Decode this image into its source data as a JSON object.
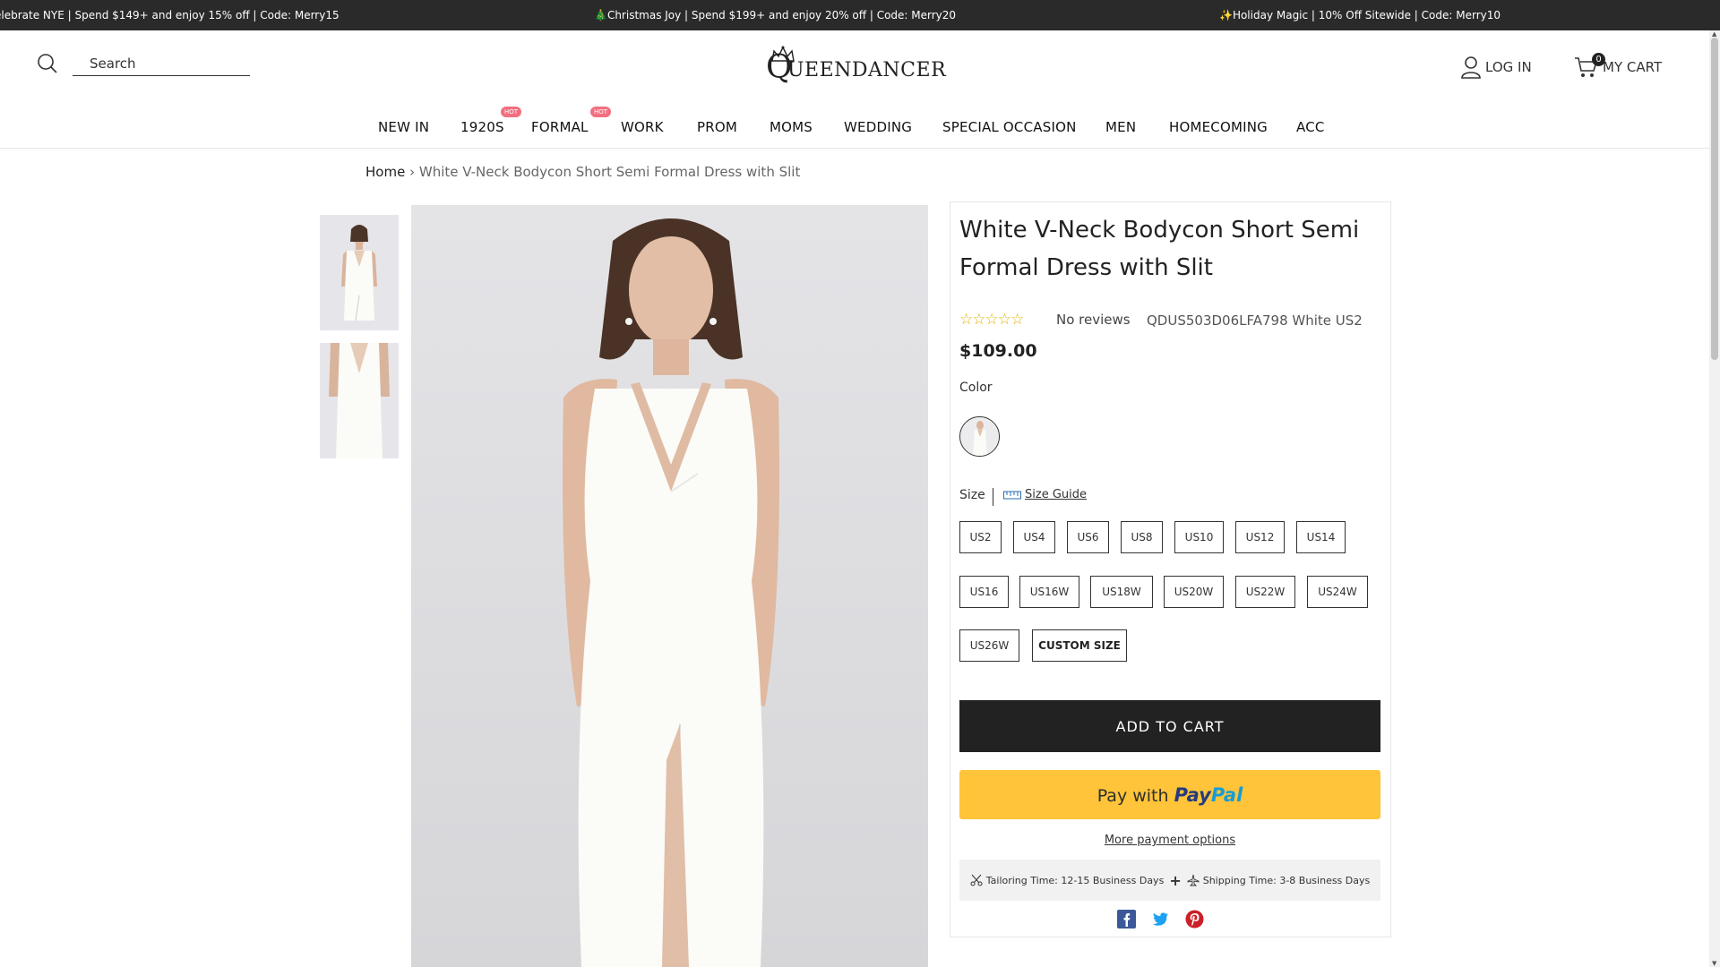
{
  "announcement": {
    "items": [
      "elebrate NYE | Spend $149+ and enjoy 15% off | Code: Merry15",
      "🎄Christmas Joy | Spend $199+ and enjoy 20% off | Code: Merry20",
      "✨Holiday Magic | 10% Off Sitewide | Code: Merry10"
    ]
  },
  "header": {
    "search_placeholder": "Search",
    "logo_initial": "Q",
    "logo_text": "UEENDANCER",
    "login_label": "LOG IN",
    "cart_label": "MY CART",
    "cart_count": "0"
  },
  "nav": {
    "items": [
      {
        "label": "NEW IN"
      },
      {
        "label": "1920S",
        "badge": "HOT"
      },
      {
        "label": "FORMAL",
        "badge": "HOT"
      },
      {
        "label": "WORK"
      },
      {
        "label": "PROM"
      },
      {
        "label": "MOMS"
      },
      {
        "label": "WEDDING"
      },
      {
        "label": "SPECIAL OCCASION"
      },
      {
        "label": "MEN"
      },
      {
        "label": "HOMECOMING"
      },
      {
        "label": "ACC"
      }
    ]
  },
  "breadcrumb": {
    "home": "Home",
    "separator": "›",
    "current": "White V-Neck Bodycon Short Semi Formal Dress with Slit"
  },
  "product": {
    "title": "White V-Neck Bodycon Short Semi Formal Dress with Slit",
    "stars": "☆☆☆☆☆",
    "rating_value": 0,
    "reviews": "No reviews",
    "sku": "QDUS503D06LFA798 White US2",
    "price": "$109.00",
    "color_label": "Color",
    "size_label": "Size",
    "size_guide": "Size Guide",
    "sizes": [
      "US2",
      "US4",
      "US6",
      "US8",
      "US10",
      "US12",
      "US14",
      "US16",
      "US16W",
      "US18W",
      "US20W",
      "US22W",
      "US24W",
      "US26W",
      "CUSTOM SIZE"
    ],
    "add_to_cart": "ADD TO CART",
    "paypal_prefix": "Pay with",
    "paypal_brand_1": "Pay",
    "paypal_brand_2": "Pal",
    "more_payment": "More payment options",
    "tailoring": "Tailoring Time: 12-15 Business Days",
    "plus": "+",
    "shipping": "Shipping Time: 3-8 Business Days"
  },
  "colors": {
    "announcement_bg": "#2a2a2a",
    "hot_badge": "#f26f7f",
    "add_to_cart_bg": "#222222",
    "paypal_bg": "#ffc439",
    "star": "#e0b300",
    "facebook": "#3b5998",
    "twitter": "#1da1f2",
    "pinterest": "#cb2027"
  },
  "icons": {
    "search": "search-icon",
    "login": "user-icon",
    "cart": "cart-icon",
    "size_guide": "ruler-icon",
    "tailoring": "scissors-icon",
    "shipping": "airplane-icon",
    "social": [
      "facebook-icon",
      "twitter-icon",
      "pinterest-icon"
    ]
  }
}
